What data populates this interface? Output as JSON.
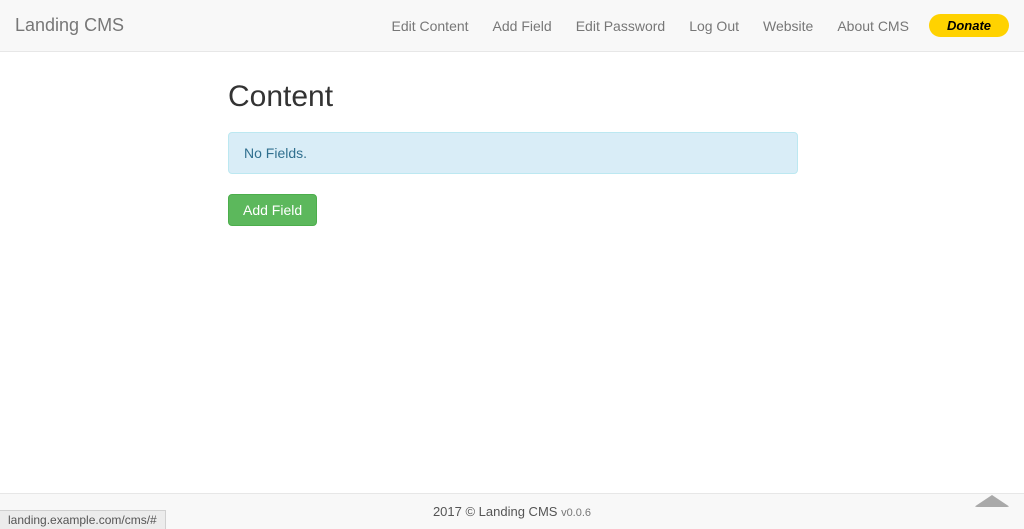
{
  "navbar": {
    "brand": "Landing CMS",
    "items": [
      {
        "label": "Edit Content"
      },
      {
        "label": "Add Field"
      },
      {
        "label": "Edit Password"
      },
      {
        "label": "Log Out"
      },
      {
        "label": "Website"
      },
      {
        "label": "About CMS"
      }
    ],
    "donate": "Donate"
  },
  "page": {
    "title": "Content",
    "alert": "No Fields.",
    "add_button": "Add Field"
  },
  "footer": {
    "copyright": "2017 © Landing CMS ",
    "version": "v0.0.6"
  },
  "status_bar": "landing.example.com/cms/#"
}
